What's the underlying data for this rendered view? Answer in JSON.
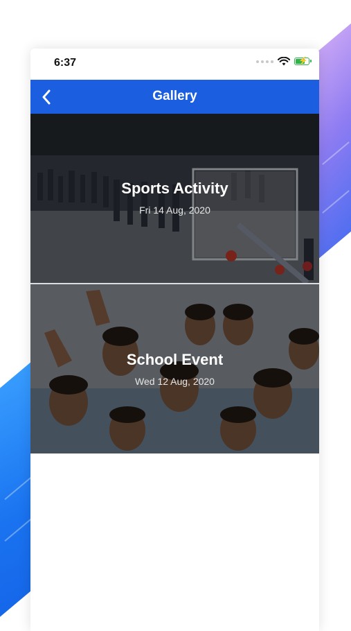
{
  "status_bar": {
    "time": "6:37",
    "wifi_icon": "wifi-icon",
    "battery_icon": "battery-charging-icon",
    "battery_level": 0.8
  },
  "header": {
    "title": "Gallery",
    "back_icon": "chevron-left-icon",
    "background_color": "#1b5fe0"
  },
  "gallery": {
    "items": [
      {
        "title": "Sports Activity",
        "date": "Fri 14 Aug, 2020"
      },
      {
        "title": "School Event",
        "date": "Wed 12 Aug, 2020"
      }
    ]
  }
}
